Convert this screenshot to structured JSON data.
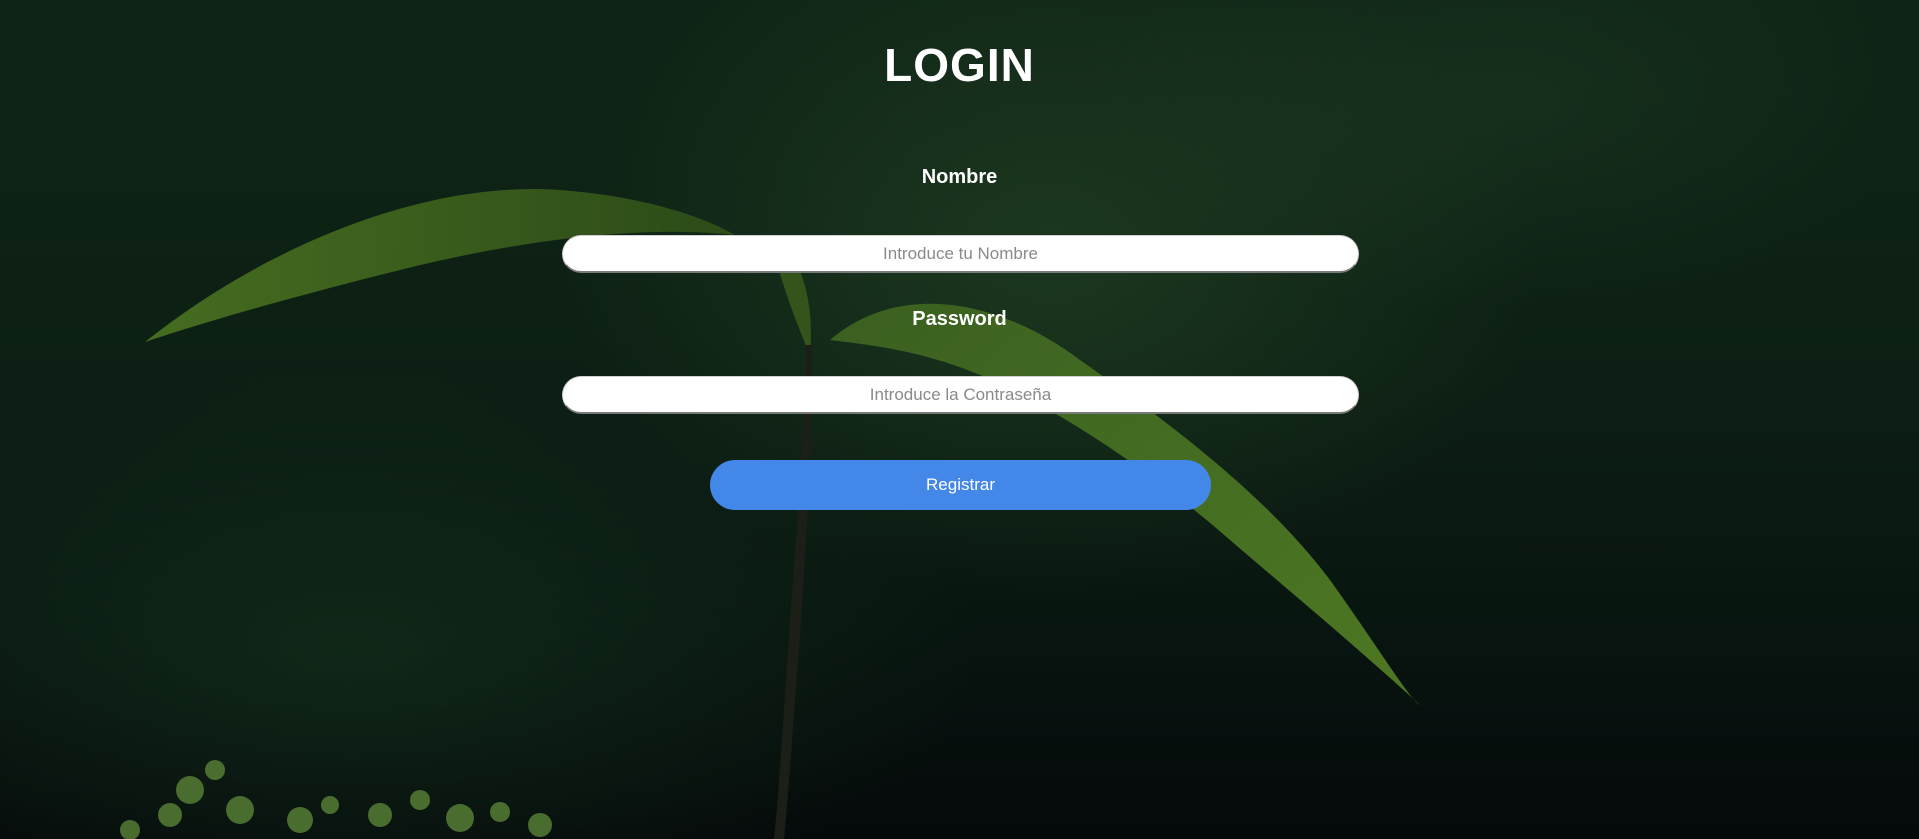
{
  "page": {
    "title": "LOGIN"
  },
  "form": {
    "name_label": "Nombre",
    "name_placeholder": "Introduce tu Nombre",
    "name_value": "",
    "password_label": "Password",
    "password_placeholder": "Introduce la Contraseña",
    "password_value": "",
    "submit_label": "Registrar"
  },
  "colors": {
    "button": "#4387e8",
    "text": "#ffffff",
    "background": "#0d1f14"
  },
  "background": {
    "image": "plant-seedling-photo"
  }
}
